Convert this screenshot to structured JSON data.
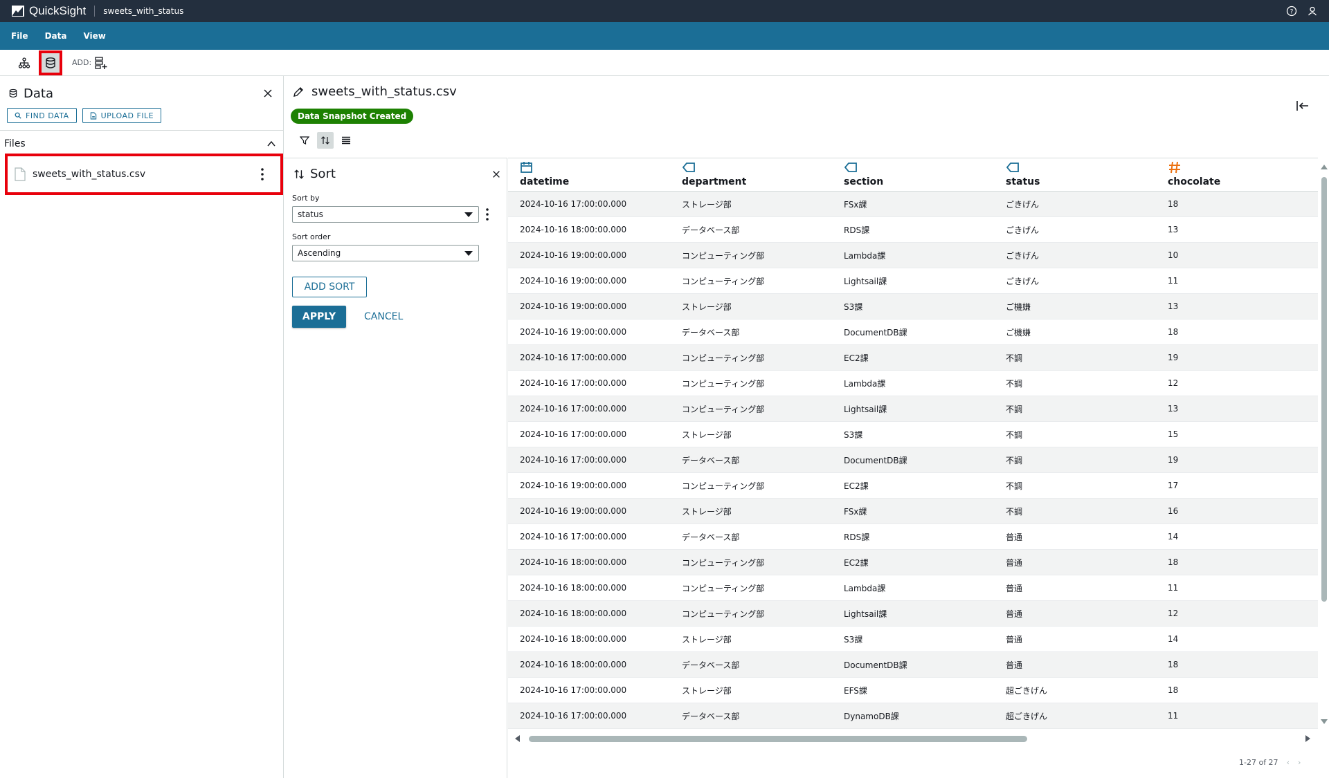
{
  "titlebar": {
    "app_name": "QuickSight",
    "file_name": "sweets_with_status"
  },
  "menubar": {
    "items": [
      "File",
      "Data",
      "View"
    ]
  },
  "toolbar": {
    "add_label": "ADD:"
  },
  "left_panel": {
    "title": "Data",
    "find_data": "FIND DATA",
    "upload_file": "UPLOAD FILE",
    "files_header": "Files",
    "file_name": "sweets_with_status.csv"
  },
  "main": {
    "dataset_title": "sweets_with_status.csv",
    "badge": "Data Snapshot Created"
  },
  "sort_panel": {
    "title": "Sort",
    "sort_by_label": "Sort by",
    "sort_by_value": "status",
    "sort_order_label": "Sort order",
    "sort_order_value": "Ascending",
    "add_sort": "ADD SORT",
    "apply": "APPLY",
    "cancel": "CANCEL"
  },
  "table": {
    "columns": [
      {
        "name": "datetime",
        "icon": "calendar-icon"
      },
      {
        "name": "department",
        "icon": "tag-icon"
      },
      {
        "name": "section",
        "icon": "tag-icon"
      },
      {
        "name": "status",
        "icon": "tag-icon"
      },
      {
        "name": "chocolate",
        "icon": "hash-icon"
      }
    ],
    "rows": [
      [
        "2024-10-16 17:00:00.000",
        "ストレージ部",
        "FSx課",
        "ごきげん",
        "18"
      ],
      [
        "2024-10-16 18:00:00.000",
        "データベース部",
        "RDS課",
        "ごきげん",
        "13"
      ],
      [
        "2024-10-16 19:00:00.000",
        "コンピューティング部",
        "Lambda課",
        "ごきげん",
        "10"
      ],
      [
        "2024-10-16 19:00:00.000",
        "コンピューティング部",
        "Lightsail課",
        "ごきげん",
        "11"
      ],
      [
        "2024-10-16 19:00:00.000",
        "ストレージ部",
        "S3課",
        "ご機嫌",
        "13"
      ],
      [
        "2024-10-16 19:00:00.000",
        "データベース部",
        "DocumentDB課",
        "ご機嫌",
        "18"
      ],
      [
        "2024-10-16 17:00:00.000",
        "コンピューティング部",
        "EC2課",
        "不調",
        "19"
      ],
      [
        "2024-10-16 17:00:00.000",
        "コンピューティング部",
        "Lambda課",
        "不調",
        "12"
      ],
      [
        "2024-10-16 17:00:00.000",
        "コンピューティング部",
        "Lightsail課",
        "不調",
        "13"
      ],
      [
        "2024-10-16 17:00:00.000",
        "ストレージ部",
        "S3課",
        "不調",
        "15"
      ],
      [
        "2024-10-16 17:00:00.000",
        "データベース部",
        "DocumentDB課",
        "不調",
        "19"
      ],
      [
        "2024-10-16 19:00:00.000",
        "コンピューティング部",
        "EC2課",
        "不調",
        "17"
      ],
      [
        "2024-10-16 19:00:00.000",
        "ストレージ部",
        "FSx課",
        "不調",
        "16"
      ],
      [
        "2024-10-16 17:00:00.000",
        "データベース部",
        "RDS課",
        "普通",
        "14"
      ],
      [
        "2024-10-16 18:00:00.000",
        "コンピューティング部",
        "EC2課",
        "普通",
        "18"
      ],
      [
        "2024-10-16 18:00:00.000",
        "コンピューティング部",
        "Lambda課",
        "普通",
        "11"
      ],
      [
        "2024-10-16 18:00:00.000",
        "コンピューティング部",
        "Lightsail課",
        "普通",
        "12"
      ],
      [
        "2024-10-16 18:00:00.000",
        "ストレージ部",
        "S3課",
        "普通",
        "14"
      ],
      [
        "2024-10-16 18:00:00.000",
        "データベース部",
        "DocumentDB課",
        "普通",
        "18"
      ],
      [
        "2024-10-16 17:00:00.000",
        "ストレージ部",
        "EFS課",
        "超ごきげん",
        "18"
      ],
      [
        "2024-10-16 17:00:00.000",
        "データベース部",
        "DynamoDB課",
        "超ごきげん",
        "11"
      ]
    ]
  },
  "pager": {
    "text": "1-27 of 27"
  },
  "colors": {
    "titlebar": "#232f3e",
    "menubar": "#1b6e96",
    "badge": "#1d8102",
    "highlight": "#e8000b",
    "accent": "#1b6e96"
  }
}
